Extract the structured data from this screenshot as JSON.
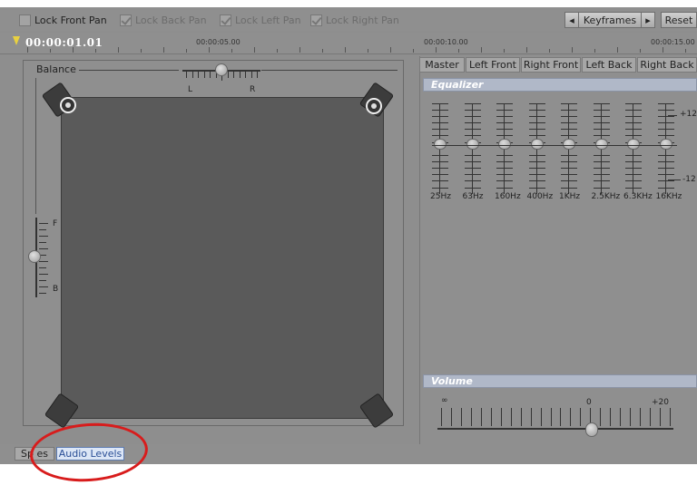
{
  "toolbar": {
    "locks": [
      {
        "label": "Lock Front Pan",
        "checked": false,
        "enabled": true
      },
      {
        "label": "Lock Back Pan",
        "checked": true,
        "enabled": false
      },
      {
        "label": "Lock Left Pan",
        "checked": true,
        "enabled": false
      },
      {
        "label": "Lock Right Pan",
        "checked": true,
        "enabled": false
      }
    ],
    "keyframes_label": "Keyframes",
    "prev_glyph": "◂",
    "next_glyph": "▸",
    "reset_label": "Reset"
  },
  "timeline": {
    "current_time": "00:00:01.01",
    "ticks": [
      "00:00:05.00",
      "00:00:10.00",
      "00:00:15.00"
    ],
    "marker_color": "#e8d040"
  },
  "pan": {
    "balance_label": "Balance",
    "left_label": "L",
    "right_label": "R",
    "front_label": "F",
    "back_label": "B"
  },
  "channels": {
    "tabs": [
      {
        "label": "Master",
        "active": true,
        "enabled": true
      },
      {
        "label": "Left Front",
        "active": false,
        "enabled": true
      },
      {
        "label": "Right Front",
        "active": false,
        "enabled": true
      },
      {
        "label": "Left Back",
        "active": false,
        "enabled": false
      },
      {
        "label": "Right Back",
        "active": false,
        "enabled": false
      }
    ]
  },
  "equalizer": {
    "title": "Equalizer",
    "max_label": "+12",
    "min_label": "-12",
    "bands": [
      {
        "label": "25Hz",
        "gain_db": 0
      },
      {
        "label": "63Hz",
        "gain_db": 0
      },
      {
        "label": "160Hz",
        "gain_db": 0
      },
      {
        "label": "400Hz",
        "gain_db": 0
      },
      {
        "label": "1KHz",
        "gain_db": 0
      },
      {
        "label": "2.5KHz",
        "gain_db": 0
      },
      {
        "label": "6.3KHz",
        "gain_db": 0
      },
      {
        "label": "16KHz",
        "gain_db": 0
      }
    ]
  },
  "volume": {
    "title": "Volume",
    "min_label": "∞",
    "zero_label": "0",
    "max_label": "+20",
    "value_db": 0
  },
  "bottom_tabs": [
    {
      "label": "Sp  es",
      "active": false
    },
    {
      "label": "Audio Levels",
      "active": true
    }
  ],
  "annotation_color": "#d81c1c"
}
